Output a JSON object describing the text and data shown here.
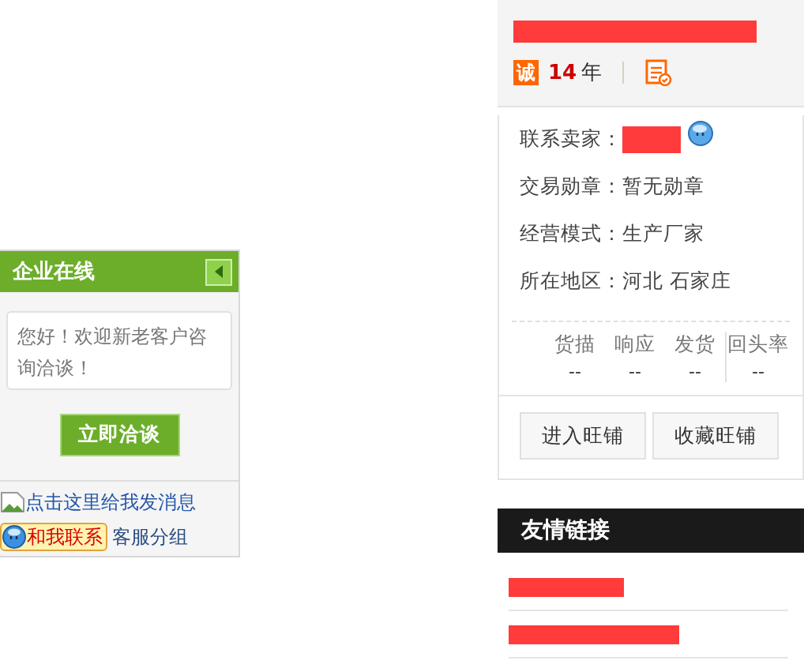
{
  "shop_card": {
    "title_redacted": true,
    "badge": "诚",
    "years": "14",
    "years_unit": "年"
  },
  "info_rows": [
    {
      "label": "联系卖家：",
      "kind": "redacted"
    },
    {
      "label": "交易勋章：",
      "value": "暂无勋章",
      "kind": "text"
    },
    {
      "label": "经营模式：",
      "value": "生产厂家",
      "kind": "text"
    },
    {
      "label": "所在地区：",
      "value": "河北 石家庄",
      "kind": "text"
    }
  ],
  "stats": [
    {
      "label": "货描",
      "value": "--"
    },
    {
      "label": "响应",
      "value": "--"
    },
    {
      "label": "发货",
      "value": "--"
    },
    {
      "label": "回头率",
      "value": "--"
    }
  ],
  "shop_buttons": [
    "进入旺铺",
    "收藏旺铺"
  ],
  "friend_links": {
    "title": "友情链接",
    "items": [
      {
        "redacted": true
      },
      {
        "redacted": true
      }
    ]
  },
  "chat_widget": {
    "title": "企业在线",
    "greeting": "您好！欢迎新老客户咨询洽谈！",
    "button": "立即洽谈",
    "message_link": "点击这里给我发消息",
    "contact_badge": "和我联系",
    "group": "客服分组"
  }
}
